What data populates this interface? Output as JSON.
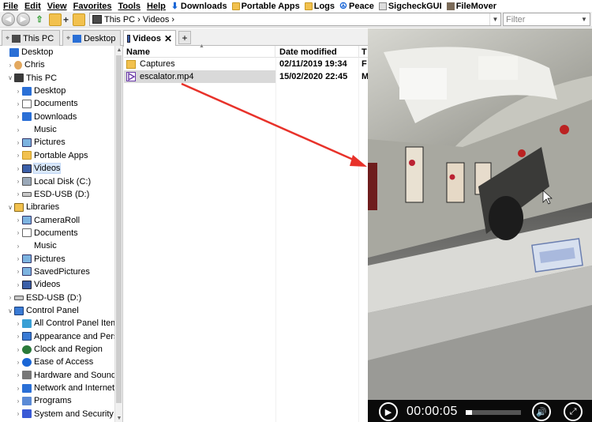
{
  "menubar": {
    "items": [
      "File",
      "Edit",
      "View",
      "Favorites",
      "Tools",
      "Help"
    ],
    "favorites": [
      {
        "label": "Downloads",
        "icon": "download-arrow-icon"
      },
      {
        "label": "Portable Apps",
        "icon": "folder-icon"
      },
      {
        "label": "Logs",
        "icon": "folder-icon"
      },
      {
        "label": "Peace",
        "icon": "peace-icon"
      },
      {
        "label": "SigcheckGUI",
        "icon": "sigcheck-icon"
      },
      {
        "label": "FileMover",
        "icon": "truck-icon"
      }
    ]
  },
  "address": {
    "path": "This PC › Videos ›",
    "filter_placeholder": "Filter"
  },
  "tabs": [
    {
      "label": "This PC",
      "active": false
    },
    {
      "label": "Desktop",
      "active": false
    },
    {
      "label": "Videos",
      "active": true
    }
  ],
  "tree": [
    {
      "label": "Desktop",
      "icon": "desktop",
      "level": 0,
      "exp": ""
    },
    {
      "label": "Chris",
      "icon": "user",
      "level": 1,
      "exp": "›"
    },
    {
      "label": "This PC",
      "icon": "pc",
      "level": 1,
      "exp": "∨"
    },
    {
      "label": "Desktop",
      "icon": "desktop",
      "level": 2,
      "exp": "›"
    },
    {
      "label": "Documents",
      "icon": "docs",
      "level": 2,
      "exp": "›"
    },
    {
      "label": "Downloads",
      "icon": "downloads",
      "level": 2,
      "exp": "›"
    },
    {
      "label": "Music",
      "icon": "music",
      "level": 2,
      "exp": "›"
    },
    {
      "label": "Pictures",
      "icon": "pictures",
      "level": 2,
      "exp": "›"
    },
    {
      "label": "Portable Apps",
      "icon": "folder",
      "level": 2,
      "exp": "›"
    },
    {
      "label": "Videos",
      "icon": "videos",
      "level": 2,
      "exp": "›",
      "selected": true
    },
    {
      "label": "Local Disk (C:)",
      "icon": "disk",
      "level": 2,
      "exp": "›"
    },
    {
      "label": "ESD-USB (D:)",
      "icon": "usb",
      "level": 2,
      "exp": "›"
    },
    {
      "label": "Libraries",
      "icon": "libraries",
      "level": 1,
      "exp": "∨"
    },
    {
      "label": "CameraRoll",
      "icon": "pictures",
      "level": 2,
      "exp": "›"
    },
    {
      "label": "Documents",
      "icon": "docs",
      "level": 2,
      "exp": "›"
    },
    {
      "label": "Music",
      "icon": "music",
      "level": 2,
      "exp": "›"
    },
    {
      "label": "Pictures",
      "icon": "pictures",
      "level": 2,
      "exp": "›"
    },
    {
      "label": "SavedPictures",
      "icon": "pictures",
      "level": 2,
      "exp": "›"
    },
    {
      "label": "Videos",
      "icon": "videos",
      "level": 2,
      "exp": "›"
    },
    {
      "label": "ESD-USB (D:)",
      "icon": "usb",
      "level": 1,
      "exp": "›"
    },
    {
      "label": "Control Panel",
      "icon": "cpanel",
      "level": 1,
      "exp": "∨"
    },
    {
      "label": "All Control Panel Item",
      "icon": "cp-ok",
      "level": 2,
      "exp": "›"
    },
    {
      "label": "Appearance and Pers",
      "icon": "cpanel",
      "level": 2,
      "exp": "›"
    },
    {
      "label": "Clock and Region",
      "icon": "clock",
      "level": 2,
      "exp": "›"
    },
    {
      "label": "Ease of Access",
      "icon": "ease",
      "level": 2,
      "exp": "›"
    },
    {
      "label": "Hardware and Sound",
      "icon": "hw",
      "level": 2,
      "exp": "›"
    },
    {
      "label": "Network and Internet",
      "icon": "net",
      "level": 2,
      "exp": "›"
    },
    {
      "label": "Programs",
      "icon": "prog",
      "level": 2,
      "exp": "›"
    },
    {
      "label": "System and Security",
      "icon": "sec",
      "level": 2,
      "exp": "›"
    }
  ],
  "filelist": {
    "columns": [
      "Name",
      "Date modified",
      "T"
    ],
    "rows": [
      {
        "name": "Captures",
        "date": "02/11/2019 19:34",
        "type": "F",
        "icon": "folder",
        "selected": false
      },
      {
        "name": "escalator.mp4",
        "date": "15/02/2020 22:45",
        "type": "M",
        "icon": "video",
        "selected": true
      }
    ]
  },
  "player": {
    "time": "00:00:05",
    "progress_fraction": 0.12
  },
  "colors": {
    "selection": "#d9e8fb",
    "annotation_arrow": "#e8322a",
    "chrome": "#f0f0f0"
  }
}
